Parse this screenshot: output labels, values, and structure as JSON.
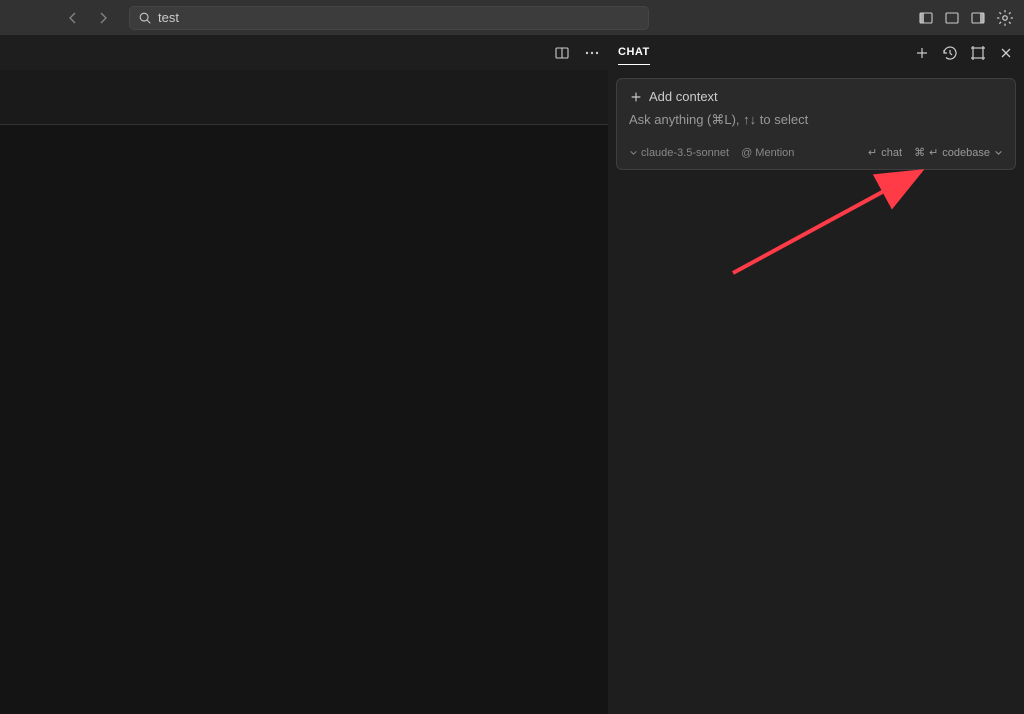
{
  "titlebar": {
    "search_text": "test"
  },
  "chat": {
    "tab_label": "CHAT",
    "add_context_label": "Add context",
    "ask_placeholder": "Ask anything (⌘L), ↑↓ to select",
    "model_name": "claude-3.5-sonnet",
    "mention_label": "@ Mention",
    "chat_btn_label": "chat",
    "codebase_btn_label": "codebase",
    "enter_symbol": "↵",
    "cmd_symbol": "⌘"
  }
}
